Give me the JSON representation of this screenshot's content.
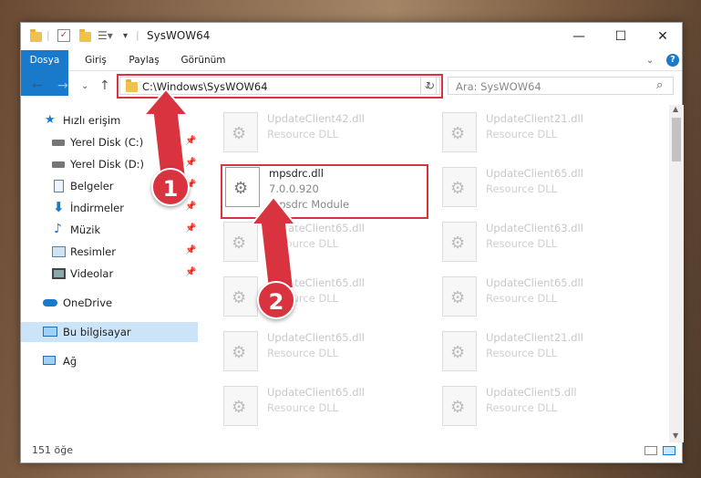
{
  "window": {
    "title": "SysWOW64",
    "minimize": "—",
    "maximize": "☐",
    "close": "✕"
  },
  "ribbon": {
    "tabs": [
      "Dosya",
      "Giriş",
      "Paylaş",
      "Görünüm"
    ],
    "collapse": "⌄",
    "help": "?"
  },
  "address": {
    "back": "←",
    "forward": "→",
    "recent": "⌄",
    "up": "↑",
    "path": "C:\\Windows\\SysWOW64",
    "dropdown": "⌄",
    "refresh": "↻",
    "search_placeholder": "Ara: SysWOW64",
    "search_icon": "⌕"
  },
  "sidebar": {
    "quick_access": "Hızlı erişim",
    "items": [
      {
        "label": "Yerel Disk (C:)",
        "icon": "drive-icon"
      },
      {
        "label": "Yerel Disk (D:)",
        "icon": "drive-icon"
      },
      {
        "label": "Belgeler",
        "icon": "documents-icon"
      },
      {
        "label": "İndirmeler",
        "icon": "download-icon"
      },
      {
        "label": "Müzik",
        "icon": "music-icon"
      },
      {
        "label": "Resimler",
        "icon": "pictures-icon"
      },
      {
        "label": "Videolar",
        "icon": "videos-icon"
      }
    ],
    "onedrive": "OneDrive",
    "this_pc": "Bu bilgisayar",
    "network": "Ağ"
  },
  "files": {
    "focused": {
      "name": "mpsdrc.dll",
      "version": "7.0.0.920",
      "description": "mpsdrc Module"
    },
    "rows": [
      {
        "left": {
          "name": "UpdateClient42.dll",
          "desc": "Resource DLL"
        },
        "right": {
          "name": "UpdateClient21.dll",
          "desc": "Resource DLL"
        }
      },
      {
        "left": null,
        "right": {
          "name": "UpdateClient65.dll",
          "desc": "Resource DLL"
        }
      },
      {
        "left": {
          "name": "UpdateClient65.dll",
          "desc": "Resource DLL"
        },
        "right": {
          "name": "UpdateClient63.dll",
          "desc": "Resource DLL"
        }
      },
      {
        "left": {
          "name": "UpdateClient65.dll",
          "desc": "Resource DLL"
        },
        "right": {
          "name": "UpdateClient65.dll",
          "desc": "Resource DLL"
        }
      },
      {
        "left": {
          "name": "UpdateClient65.dll",
          "desc": "Resource DLL"
        },
        "right": {
          "name": "UpdateClient21.dll",
          "desc": "Resource DLL"
        }
      },
      {
        "left": {
          "name": "UpdateClient65.dll",
          "desc": "Resource DLL"
        },
        "right": {
          "name": "UpdateClient5.dll",
          "desc": "Resource DLL"
        }
      }
    ]
  },
  "status": {
    "count": "151 öğe"
  },
  "callouts": [
    "1",
    "2"
  ],
  "colors": {
    "accent": "#1979ca",
    "highlight": "#d9333f",
    "selection": "#cce4f7"
  }
}
